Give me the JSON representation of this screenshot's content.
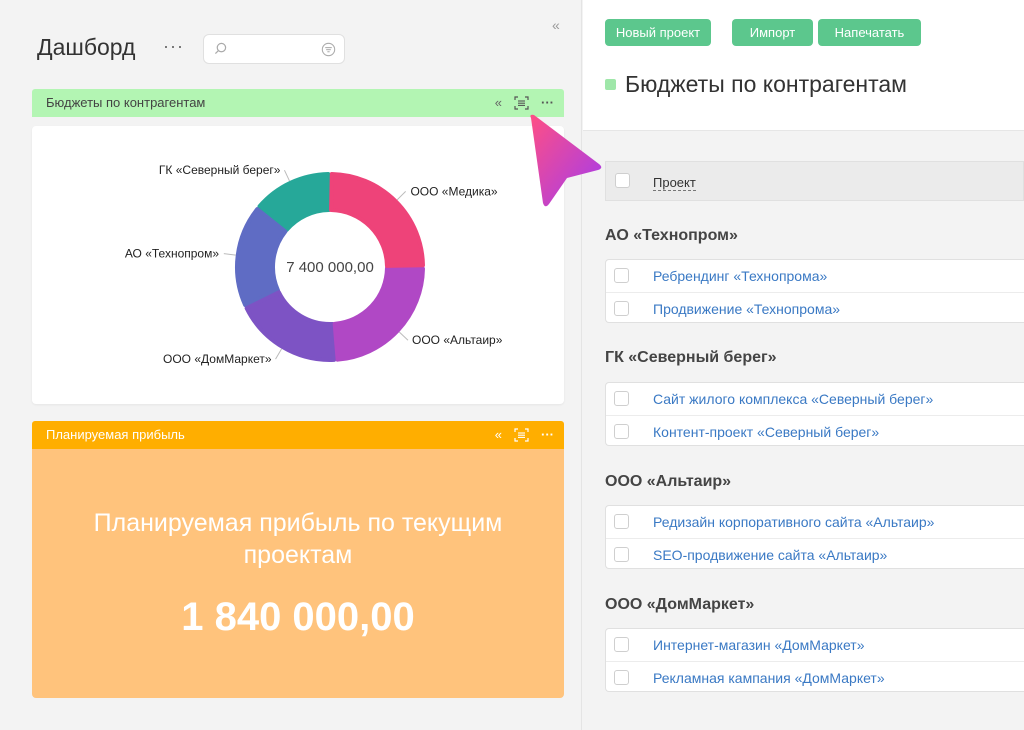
{
  "dashboard": {
    "title": "Дашборд",
    "more": "···"
  },
  "widget1": {
    "title": "Бюджеты по контрагентам",
    "center_value": "7 400 000,00"
  },
  "widget2": {
    "title": "Планируемая прибыль",
    "label": "Планируемая прибыль по текущим проектам",
    "value": "1 840 000,00"
  },
  "chart_data": {
    "type": "pie",
    "donut": true,
    "total_label": "7 400 000,00",
    "slices": [
      {
        "label": "ООО «Медика»",
        "value": 0.25,
        "color": "#ee4379"
      },
      {
        "label": "ООО «Альтаир»",
        "value": 0.24,
        "color": "#b048c5"
      },
      {
        "label": "ООО «ДомМаркет»",
        "value": 0.19,
        "color": "#7d53c4"
      },
      {
        "label": "АО «Технопром»",
        "value": 0.18,
        "color": "#5f6cc4"
      },
      {
        "label": "ГК «Северный берег»",
        "value": 0.14,
        "color": "#26a899"
      }
    ]
  },
  "toolbar": {
    "new_project": "Новый проект",
    "import": "Импорт",
    "print": "Напечатать"
  },
  "detail": {
    "title": "Бюджеты по контрагентам",
    "column": "Проект",
    "groups": [
      {
        "name": "АО «Технопром»",
        "rows": [
          "Ребрендинг «Технопрома»",
          "Продвижение «Технопрома»"
        ]
      },
      {
        "name": "ГК «Северный берег»",
        "rows": [
          "Сайт жилого комплекса «Северный берег»",
          "Контент-проект «Северный берег»"
        ]
      },
      {
        "name": "ООО «Альтаир»",
        "rows": [
          "Редизайн корпоративного сайта «Альтаир»",
          "SEO-продвижение сайта «Альтаир»"
        ]
      },
      {
        "name": "ООО «ДомМаркет»",
        "rows": [
          "Интернет-магазин «ДомМаркет»",
          "Рекламная кампания «ДомМаркет»"
        ]
      }
    ]
  },
  "colors": {
    "accent_green": "#5cc78d",
    "widget1_header": "#b3f5b3",
    "widget2_header": "#ffae00",
    "widget2_body": "#ffc37c",
    "link": "#3a79c4"
  }
}
